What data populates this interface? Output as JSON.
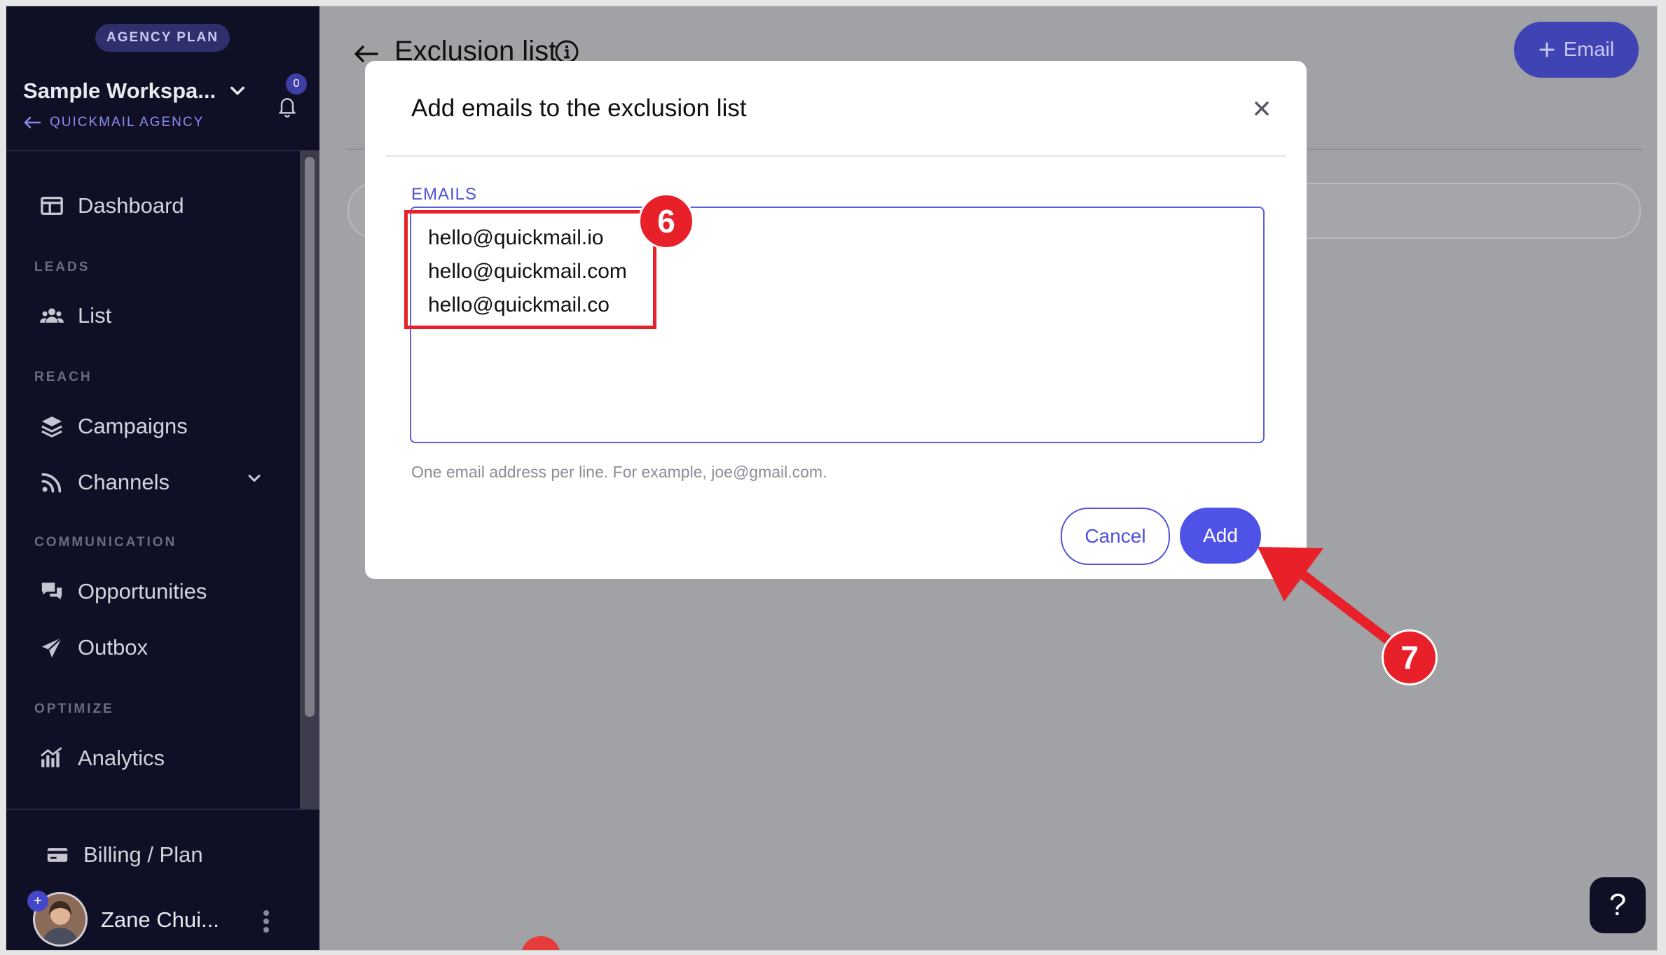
{
  "sidebar": {
    "plan_badge": "AGENCY PLAN",
    "workspace_name": "Sample Workspa...",
    "workspace_sub": "QUICKMAIL AGENCY",
    "notification_count": "0",
    "items": [
      {
        "label": "Dashboard",
        "icon": "dashboard-icon"
      },
      {
        "section": "LEADS"
      },
      {
        "label": "List",
        "icon": "users-icon"
      },
      {
        "section": "REACH"
      },
      {
        "label": "Campaigns",
        "icon": "layers-icon"
      },
      {
        "label": "Channels",
        "icon": "rss-icon"
      },
      {
        "section": "COMMUNICATION"
      },
      {
        "label": "Opportunities",
        "icon": "chat-icon"
      },
      {
        "label": "Outbox",
        "icon": "paper-plane-icon"
      },
      {
        "section": "OPTIMIZE"
      },
      {
        "label": "Analytics",
        "icon": "chart-icon"
      }
    ],
    "billing_label": "Billing / Plan",
    "user_name": "Zane Chui..."
  },
  "main": {
    "page_title": "Exclusion list",
    "email_button": "Email",
    "help_button": "?"
  },
  "modal": {
    "title": "Add emails to the exclusion list",
    "field_label": "EMAILS",
    "emails": [
      "hello@quickmail.io",
      "hello@quickmail.com",
      "hello@quickmail.co"
    ],
    "help_text": "One email address per line. For example, joe@gmail.com.",
    "cancel_label": "Cancel",
    "add_label": "Add"
  },
  "annotations": {
    "step_6": "6",
    "step_7": "7",
    "color": "#e8202a"
  }
}
